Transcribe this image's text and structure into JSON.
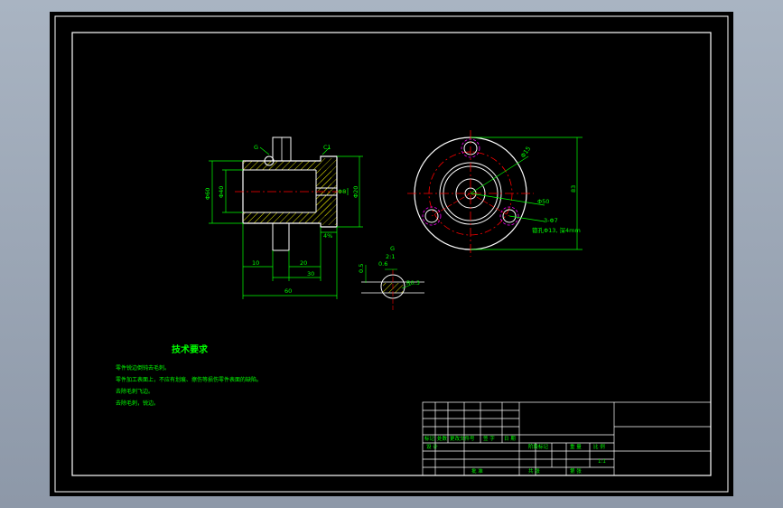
{
  "colors": {
    "background": "#000000",
    "frame": "#ffffff",
    "geometry": "#ffffff",
    "dimension": "#00ff00",
    "centerline": "#ff0000",
    "hidden": "#ff00ff",
    "hatch": "#ffff00",
    "requirement_text": "#00ff00"
  },
  "front_view": {
    "chamfer": "C1",
    "diameter_left_outer": "Φ60",
    "diameter_left_inner": "Φ40",
    "diameter_right": "Φ20",
    "bore_small": "Φ8",
    "dim_bottom_1": "10",
    "dim_bottom_2": "20",
    "dim_bottom_3": "30",
    "dim_overall": "60",
    "tolerance_note": "4%",
    "section_marker": "G"
  },
  "side_view": {
    "dia_top": "Φ15",
    "dia_middle": "Φ50",
    "height": "83",
    "holes": "3-Φ7",
    "hole_note": "锪孔Φ13, 深4mm"
  },
  "detail_view": {
    "label": "G",
    "scale": "2:1",
    "dim_left": "0.5",
    "dim_top": "0.6",
    "dim_angle": "R0.3"
  },
  "requirements": {
    "title": "技术要求",
    "items": [
      "零件锐边倒钝去毛刺。",
      "零件加工表面上，不应有划痕、擦伤等损伤零件表面的缺陷。",
      "去除毛刺飞边。",
      "去除毛刺，锐边。"
    ]
  },
  "title_block": {
    "scale": "1:1",
    "header_cells": [
      "标记",
      "处数",
      "更改文件号",
      "签 字",
      "日 期"
    ],
    "row_design": "设 计",
    "stage": "阶段标记",
    "weight": "重 量",
    "ratio": "比 例",
    "sheets": "共  张",
    "sheet_no": "第  张",
    "approve": "批 准"
  }
}
